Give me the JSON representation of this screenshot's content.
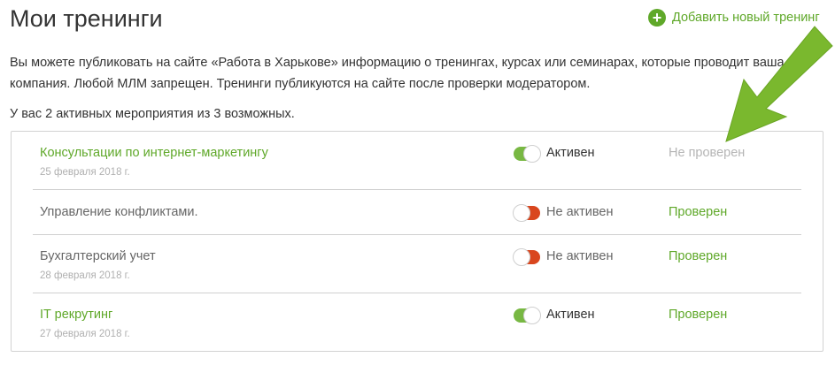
{
  "header": {
    "title": "Мои тренинги",
    "add_label": "Добавить новый тренинг",
    "add_icon": "plus-circle-icon"
  },
  "intro": {
    "text": "Вы можете публиковать на сайте «Работа в Харькове» информацию о тренингах, курсах или семинарах, которые проводит ваша компания. Любой МЛМ запрещен. Тренинги публикуются на сайте после проверки модератором."
  },
  "summary": {
    "text": "У вас 2 активных мероприятия из 3 возможных."
  },
  "trainings": [
    {
      "title": "Консультации по интернет-маркетингу",
      "date": "25 февраля 2018 г.",
      "active": true,
      "status": "Активен",
      "moderation": "Не проверен",
      "moderated": false
    },
    {
      "title": "Управление конфликтами.",
      "date": "",
      "active": false,
      "status": "Не активен",
      "moderation": "Проверен",
      "moderated": true
    },
    {
      "title": "Бухгалтерский учет",
      "date": "28 февраля 2018 г.",
      "active": false,
      "status": "Не активен",
      "moderation": "Проверен",
      "moderated": true
    },
    {
      "title": "IT рекрутинг",
      "date": "27 февраля 2018 г.",
      "active": true,
      "status": "Активен",
      "moderation": "Проверен",
      "moderated": true
    }
  ],
  "colors": {
    "accent_green": "#5fa829",
    "toggle_on": "#78b843",
    "toggle_off": "#d9461e",
    "arrow": "#7ab82e"
  },
  "icons": {
    "pointer_arrow": "arrow-pointer-icon"
  }
}
